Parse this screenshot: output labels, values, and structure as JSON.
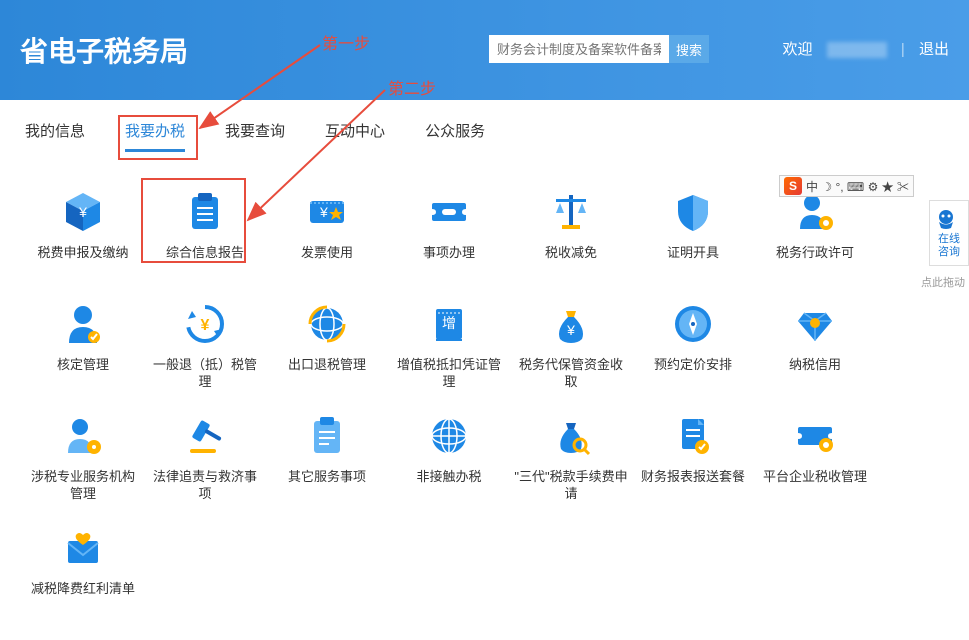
{
  "header": {
    "title": "省电子税务局",
    "search_placeholder": "财务会计制度及备案软件备案",
    "search_btn": "搜索",
    "welcome": "欢迎",
    "logout": "退出"
  },
  "tabs": [
    {
      "label": "我的信息",
      "active": false
    },
    {
      "label": "我要办税",
      "active": true
    },
    {
      "label": "我要查询",
      "active": false
    },
    {
      "label": "互动中心",
      "active": false
    },
    {
      "label": "公众服务",
      "active": false
    }
  ],
  "grid_items": [
    {
      "label": "税费申报及缴纳",
      "icon": "cube"
    },
    {
      "label": "综合信息报告",
      "icon": "clipboard"
    },
    {
      "label": "发票使用",
      "icon": "ticket-star"
    },
    {
      "label": "事项办理",
      "icon": "coupon"
    },
    {
      "label": "税收减免",
      "icon": "scale"
    },
    {
      "label": "证明开具",
      "icon": "shield"
    },
    {
      "label": "税务行政许可",
      "icon": "person-gear"
    },
    {
      "label": "核定管理",
      "icon": "person-silhouette"
    },
    {
      "label": "一般退（抵）税管理",
      "icon": "refund"
    },
    {
      "label": "出口退税管理",
      "icon": "globe-arrows"
    },
    {
      "label": "增值税抵扣凭证管理",
      "icon": "receipt"
    },
    {
      "label": "税务代保管资金收取",
      "icon": "money-bag"
    },
    {
      "label": "预约定价安排",
      "icon": "compass"
    },
    {
      "label": "纳税信用",
      "icon": "diamond"
    },
    {
      "label": "涉税专业服务机构管理",
      "icon": "person-gear2"
    },
    {
      "label": "法律追责与救济事项",
      "icon": "gavel"
    },
    {
      "label": "其它服务事项",
      "icon": "clipboard2"
    },
    {
      "label": "非接触办税",
      "icon": "globe"
    },
    {
      "label": "\"三代\"税款手续费申请",
      "icon": "money-search"
    },
    {
      "label": "财务报表报送套餐",
      "icon": "document"
    },
    {
      "label": "平台企业税收管理",
      "icon": "ticket-gear"
    },
    {
      "label": "减税降费红利清单",
      "icon": "envelope-heart"
    }
  ],
  "annotations": {
    "step1": "第一步",
    "step2": "第二步"
  },
  "side": {
    "ime_logo": "S",
    "ime_text": "中 ☽ °, ⌨ ⚙ ★ ✂",
    "consult": "在线咨询",
    "drag": "点此拖动"
  }
}
